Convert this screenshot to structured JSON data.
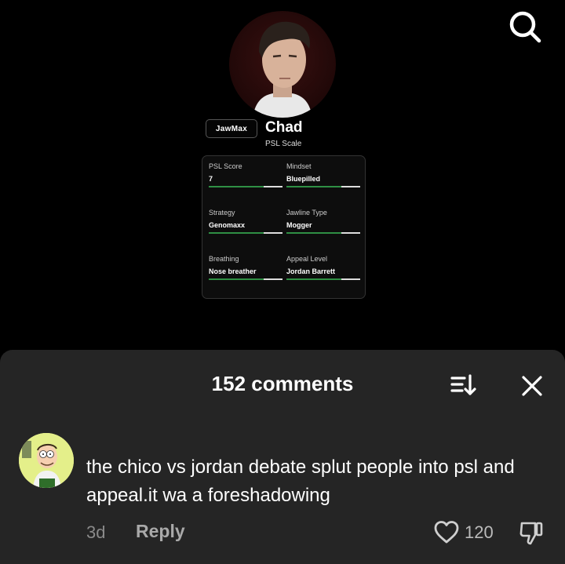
{
  "video": {
    "brand_tag": "JawMax",
    "profile_name": "Chad",
    "profile_subtitle": "PSL Scale",
    "stats": [
      {
        "label": "PSL Score",
        "value": "7"
      },
      {
        "label": "Mindset",
        "value": "Bluepilled"
      },
      {
        "label": "Strategy",
        "value": "Genomaxx"
      },
      {
        "label": "Jawline Type",
        "value": "Mogger"
      },
      {
        "label": "Breathing",
        "value": "Nose breather"
      },
      {
        "label": "Appeal Level",
        "value": "Jordan Barrett"
      }
    ]
  },
  "comments": {
    "title": "152 comments",
    "items": [
      {
        "text": "the chico vs jordan debate splut people into psl and appeal.it wa a foreshadowing",
        "time": "3d",
        "reply_label": "Reply",
        "likes": "120"
      }
    ]
  },
  "icons": {
    "search": "search-icon",
    "sort": "sort-icon",
    "close": "close-icon",
    "like": "heart-icon",
    "dislike": "thumbs-down-icon"
  },
  "colors": {
    "background": "#000000",
    "sheet": "#252525",
    "bar_fill": "#2f8f44",
    "muted_text": "#8a8a8a"
  }
}
